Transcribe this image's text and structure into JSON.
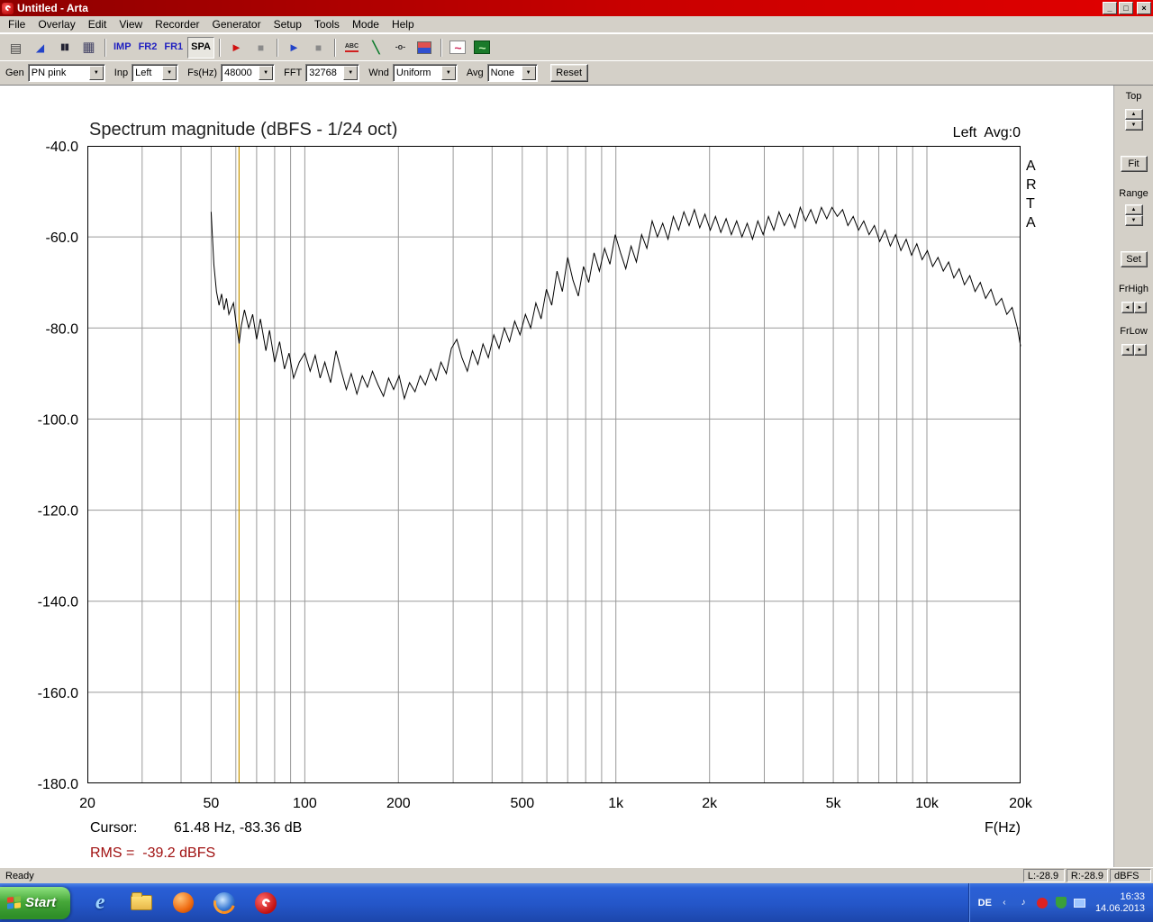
{
  "window": {
    "title": "Untitled - Arta",
    "menu": [
      "File",
      "Overlay",
      "Edit",
      "View",
      "Recorder",
      "Generator",
      "Setup",
      "Tools",
      "Mode",
      "Help"
    ]
  },
  "icons": {
    "minimize": "_",
    "maximize": "□",
    "close": "×",
    "dropdown": "▼",
    "spin_up": "▲",
    "spin_down": "▼",
    "spin_left": "◄",
    "spin_right": "►",
    "copy": "▤",
    "record_arm": "◢",
    "pause": "▮▮",
    "grid": "▦",
    "rec_play": "►",
    "rec_stop": "■",
    "play": "►",
    "stop": "■",
    "abc": "ABC",
    "diag": "╲",
    "probe": "-o-",
    "wave_pink": "~",
    "wave_green": "~",
    "ie": "e",
    "tray_hide": "‹",
    "note": "♪"
  },
  "toolbar": {
    "imp": "IMP",
    "fr2": "FR2",
    "fr1": "FR1",
    "spa": "SPA"
  },
  "controls": {
    "gen_label": "Gen",
    "gen_value": "PN pink",
    "inp_label": "Inp",
    "inp_value": "Left",
    "fs_label": "Fs(Hz)",
    "fs_value": "48000",
    "fft_label": "FFT",
    "fft_value": "32768",
    "wnd_label": "Wnd",
    "wnd_value": "Uniform",
    "avg_label": "Avg",
    "avg_value": "None",
    "reset_label": "Reset"
  },
  "side": {
    "top_label": "Top",
    "fit_label": "Fit",
    "range_label": "Range",
    "set_label": "Set",
    "frhigh_label": "FrHigh",
    "frlow_label": "FrLow"
  },
  "status": {
    "ready": "Ready",
    "left_level": "L:-28.9",
    "right_level": "R:-28.9",
    "unit": "dBFS"
  },
  "taskbar": {
    "start_label": "Start",
    "lang": "DE",
    "time": "16:33",
    "date": "14.06.2013"
  },
  "chart_data": {
    "type": "line",
    "title": "Spectrum magnitude (dBFS - 1/24 oct)",
    "channel_label": "Left  Avg:0",
    "xlabel": "F(Hz)",
    "ylabel": "dBFS",
    "x_scale": "log",
    "xlim": [
      20,
      20000
    ],
    "ylim": [
      -180,
      -40
    ],
    "grid_on": true,
    "grid_color": "#9a9a9a",
    "line_color": "#000000",
    "watermark": "ARTA",
    "x_ticks": [
      {
        "f": 20,
        "label": "20"
      },
      {
        "f": 50,
        "label": "50"
      },
      {
        "f": 100,
        "label": "100"
      },
      {
        "f": 200,
        "label": "200"
      },
      {
        "f": 500,
        "label": "500"
      },
      {
        "f": 1000,
        "label": "1k"
      },
      {
        "f": 2000,
        "label": "2k"
      },
      {
        "f": 5000,
        "label": "5k"
      },
      {
        "f": 10000,
        "label": "10k"
      },
      {
        "f": 20000,
        "label": "20k"
      }
    ],
    "y_ticks": [
      {
        "v": -40,
        "label": "-40.0"
      },
      {
        "v": -60,
        "label": "-60.0"
      },
      {
        "v": -80,
        "label": "-80.0"
      },
      {
        "v": -100,
        "label": "-100.0"
      },
      {
        "v": -120,
        "label": "-120.0"
      },
      {
        "v": -140,
        "label": "-140.0"
      },
      {
        "v": -160,
        "label": "-160.0"
      },
      {
        "v": -180,
        "label": "-180.0"
      }
    ],
    "grid_freqs": [
      30,
      40,
      50,
      60,
      70,
      80,
      90,
      100,
      200,
      300,
      400,
      500,
      600,
      700,
      800,
      900,
      1000,
      2000,
      3000,
      4000,
      5000,
      6000,
      7000,
      8000,
      9000,
      10000
    ],
    "cursor": {
      "freq": 61.48,
      "db": -83.36,
      "prefix": "Cursor:",
      "value": "61.48 Hz, -83.36 dB",
      "color": "#c89600"
    },
    "rms_label": "RMS =  -39.2 dBFS",
    "rms_color": "#a01010",
    "series": [
      {
        "name": "Left",
        "points": [
          [
            50,
            -54.5
          ],
          [
            51,
            -66
          ],
          [
            52,
            -72
          ],
          [
            53,
            -75
          ],
          [
            54,
            -72.5
          ],
          [
            55,
            -76
          ],
          [
            56,
            -73.5
          ],
          [
            57,
            -77
          ],
          [
            59,
            -74.5
          ],
          [
            60,
            -78.5
          ],
          [
            61.5,
            -83.4
          ],
          [
            62.5,
            -79.5
          ],
          [
            64,
            -76
          ],
          [
            66,
            -80
          ],
          [
            68,
            -77
          ],
          [
            70,
            -82.5
          ],
          [
            72,
            -78
          ],
          [
            75,
            -85
          ],
          [
            77,
            -80.5
          ],
          [
            80,
            -87.5
          ],
          [
            83,
            -83
          ],
          [
            86,
            -89
          ],
          [
            89,
            -85.5
          ],
          [
            92,
            -91
          ],
          [
            96,
            -87.5
          ],
          [
            100,
            -85.5
          ],
          [
            104,
            -89.5
          ],
          [
            108,
            -86
          ],
          [
            112,
            -91
          ],
          [
            116,
            -87.5
          ],
          [
            121,
            -92
          ],
          [
            126,
            -85
          ],
          [
            131,
            -89.5
          ],
          [
            136,
            -93.5
          ],
          [
            141,
            -90
          ],
          [
            147,
            -94.5
          ],
          [
            153,
            -90.5
          ],
          [
            159,
            -93
          ],
          [
            165,
            -89.5
          ],
          [
            172,
            -92.5
          ],
          [
            179,
            -95
          ],
          [
            186,
            -91
          ],
          [
            193,
            -93.5
          ],
          [
            201,
            -90.5
          ],
          [
            209,
            -95.5
          ],
          [
            217,
            -92
          ],
          [
            226,
            -94
          ],
          [
            235,
            -90.5
          ],
          [
            244,
            -92.5
          ],
          [
            254,
            -89
          ],
          [
            264,
            -91.5
          ],
          [
            274,
            -87.5
          ],
          [
            285,
            -90
          ],
          [
            296,
            -84.5
          ],
          [
            308,
            -82.5
          ],
          [
            320,
            -86.5
          ],
          [
            333,
            -89.5
          ],
          [
            346,
            -85
          ],
          [
            360,
            -88
          ],
          [
            374,
            -83.5
          ],
          [
            389,
            -86.5
          ],
          [
            405,
            -81.5
          ],
          [
            421,
            -84.5
          ],
          [
            438,
            -80
          ],
          [
            455,
            -83
          ],
          [
            473,
            -78.5
          ],
          [
            492,
            -81.5
          ],
          [
            512,
            -77
          ],
          [
            532,
            -80
          ],
          [
            553,
            -74.5
          ],
          [
            575,
            -78
          ],
          [
            598,
            -71.5
          ],
          [
            622,
            -75
          ],
          [
            647,
            -67.5
          ],
          [
            673,
            -72
          ],
          [
            700,
            -64.5
          ],
          [
            728,
            -69.5
          ],
          [
            757,
            -73
          ],
          [
            787,
            -66.5
          ],
          [
            818,
            -70
          ],
          [
            851,
            -63.5
          ],
          [
            885,
            -67.5
          ],
          [
            920,
            -62.5
          ],
          [
            957,
            -66
          ],
          [
            995,
            -59.5
          ],
          [
            1035,
            -63.5
          ],
          [
            1076,
            -67
          ],
          [
            1119,
            -62
          ],
          [
            1164,
            -65.5
          ],
          [
            1210,
            -59.5
          ],
          [
            1258,
            -62.5
          ],
          [
            1308,
            -56.5
          ],
          [
            1360,
            -60
          ],
          [
            1414,
            -57
          ],
          [
            1471,
            -60.5
          ],
          [
            1530,
            -55.5
          ],
          [
            1591,
            -58.5
          ],
          [
            1654,
            -54.5
          ],
          [
            1720,
            -57.5
          ],
          [
            1789,
            -54
          ],
          [
            1860,
            -58
          ],
          [
            1934,
            -55
          ],
          [
            2011,
            -58.5
          ],
          [
            2091,
            -55.5
          ],
          [
            2174,
            -59
          ],
          [
            2261,
            -56
          ],
          [
            2351,
            -59.5
          ],
          [
            2445,
            -56.5
          ],
          [
            2543,
            -60
          ],
          [
            2644,
            -57
          ],
          [
            2750,
            -60.5
          ],
          [
            2860,
            -56.5
          ],
          [
            2974,
            -59.5
          ],
          [
            3093,
            -55.5
          ],
          [
            3217,
            -58.5
          ],
          [
            3346,
            -54.5
          ],
          [
            3480,
            -57.5
          ],
          [
            3619,
            -55
          ],
          [
            3764,
            -58
          ],
          [
            3914,
            -53.5
          ],
          [
            4071,
            -56.5
          ],
          [
            4234,
            -54
          ],
          [
            4403,
            -57
          ],
          [
            4579,
            -53.5
          ],
          [
            4762,
            -56
          ],
          [
            4952,
            -53.5
          ],
          [
            5150,
            -55.5
          ],
          [
            5356,
            -54
          ],
          [
            5570,
            -57.5
          ],
          [
            5793,
            -55.5
          ],
          [
            6025,
            -58.5
          ],
          [
            6266,
            -56.5
          ],
          [
            6517,
            -59.5
          ],
          [
            6778,
            -57.5
          ],
          [
            7049,
            -61
          ],
          [
            7331,
            -58.5
          ],
          [
            7624,
            -62
          ],
          [
            7929,
            -59.5
          ],
          [
            8246,
            -63
          ],
          [
            8576,
            -60.5
          ],
          [
            8919,
            -64
          ],
          [
            9276,
            -61.5
          ],
          [
            9647,
            -65
          ],
          [
            10033,
            -63
          ],
          [
            10434,
            -66.5
          ],
          [
            10851,
            -64.5
          ],
          [
            11285,
            -67.5
          ],
          [
            11736,
            -65.5
          ],
          [
            12205,
            -69
          ],
          [
            12693,
            -67
          ],
          [
            13201,
            -70.5
          ],
          [
            13729,
            -68.5
          ],
          [
            14278,
            -72
          ],
          [
            14849,
            -70
          ],
          [
            15443,
            -73.5
          ],
          [
            16061,
            -71.5
          ],
          [
            16703,
            -75
          ],
          [
            17371,
            -73.5
          ],
          [
            18066,
            -77
          ],
          [
            18789,
            -75.5
          ],
          [
            19541,
            -80
          ],
          [
            20000,
            -84
          ]
        ]
      }
    ]
  }
}
